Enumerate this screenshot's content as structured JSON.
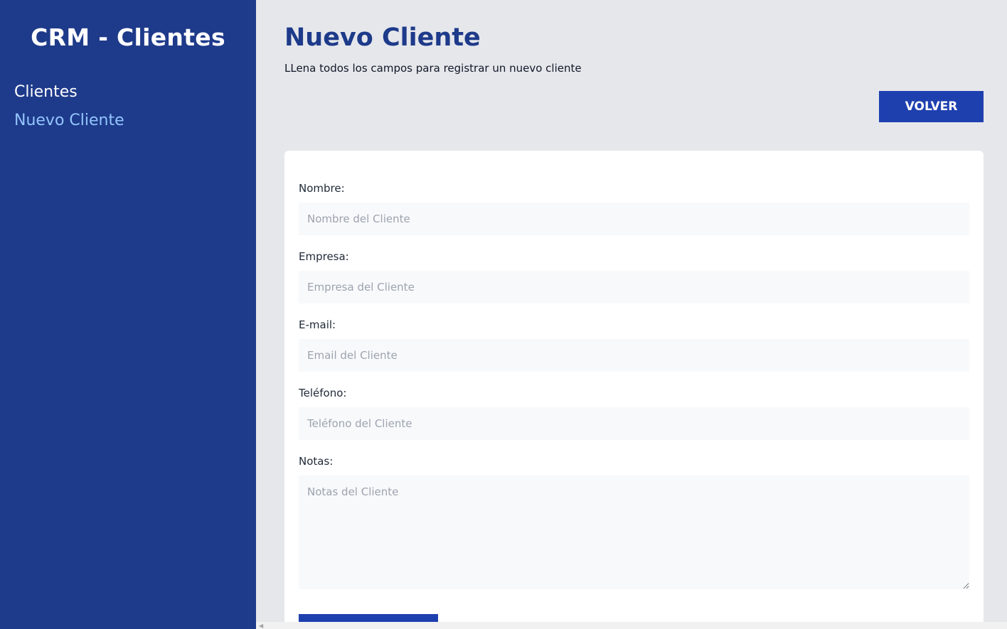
{
  "sidebar": {
    "brand": "CRM - Clientes",
    "items": [
      {
        "label": "Clientes",
        "active": false
      },
      {
        "label": "Nuevo Cliente",
        "active": true
      }
    ]
  },
  "header": {
    "title": "Nuevo Cliente",
    "subtitle": "LLena todos los campos para registrar un nuevo cliente",
    "back_button": "VOLVER"
  },
  "form": {
    "nombre": {
      "label": "Nombre:",
      "placeholder": "Nombre del Cliente",
      "value": ""
    },
    "empresa": {
      "label": "Empresa:",
      "placeholder": "Empresa del Cliente",
      "value": ""
    },
    "email": {
      "label": "E-mail:",
      "placeholder": "Email del Cliente",
      "value": ""
    },
    "telefono": {
      "label": "Teléfono:",
      "placeholder": "Teléfono del Cliente",
      "value": ""
    },
    "notas": {
      "label": "Notas:",
      "placeholder": "Notas del Cliente",
      "value": ""
    },
    "submit_label": ""
  },
  "colors": {
    "sidebar_bg": "#1e3a8a",
    "accent": "#1e40af",
    "active_link": "#93c5fd",
    "page_bg": "#e5e7eb"
  },
  "icons": {
    "scroll_left": "chevron-left-icon"
  }
}
